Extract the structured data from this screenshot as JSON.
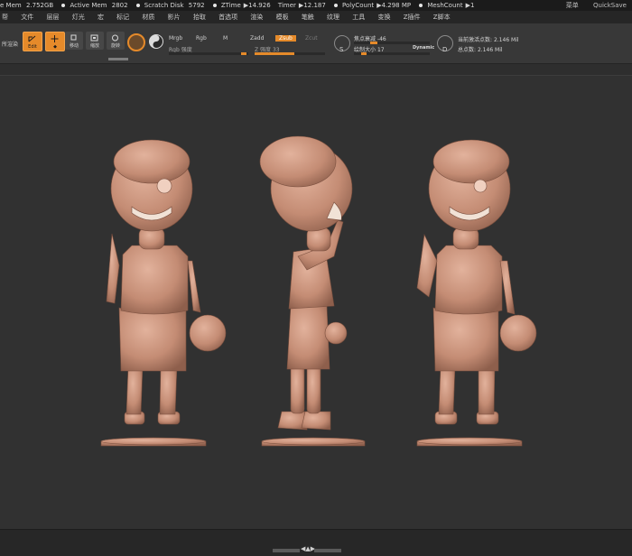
{
  "status": {
    "items": [
      {
        "label": "e Mem",
        "value": "2.752GB"
      },
      {
        "label": "Active Mem",
        "value": "2802"
      },
      {
        "label": "Scratch Disk",
        "value": "5792"
      },
      {
        "label": "ZTime",
        "value": "14.926"
      },
      {
        "label": "Timer",
        "value": "12.187"
      },
      {
        "label": "PolyCount",
        "value": "4.298 MP"
      },
      {
        "label": "MeshCount",
        "value": "1"
      }
    ],
    "right": [
      "菜单",
      "QuickSave"
    ]
  },
  "menu": [
    "帮",
    "文件",
    "层层",
    "灯光",
    "宏",
    "标记",
    "材质",
    "影片",
    "拾取",
    "首选项",
    "渲染",
    "模板",
    "笔触",
    "纹理",
    "工具",
    "变换",
    "Z插件",
    "Z脚本"
  ],
  "toolbar": {
    "left_label": "所渲染",
    "buttons": [
      {
        "label": "Edit"
      },
      {
        "label": "移动"
      },
      {
        "label": "缩放"
      },
      {
        "label": "旋转"
      }
    ],
    "modes": {
      "mrgb": "Mrgb",
      "rgb": "Rgb",
      "m": "M",
      "zadd": "Zadd",
      "zsub": "Zsub",
      "zcut": "Zcut"
    },
    "rgb_intensity_label": "Rgb 强度",
    "z_intensity_label": "Z 强度",
    "z_intensity_value": "33",
    "focal_label": "焦点衰减",
    "focal_value": "-46",
    "draw_size_label": "绘制大小",
    "draw_size_value": "17",
    "dynamic_label": "Dynamic",
    "active_points_label": "当前激活点数:",
    "active_points_value": "2.146 Mil",
    "total_points_label": "总点数:",
    "total_points_value": "2.146 Mil"
  },
  "bottom": {
    "arrows": "◀▲▶"
  },
  "colors": {
    "accent": "#e58a2a",
    "clay": "#c9907a",
    "viewport": "#313131"
  }
}
